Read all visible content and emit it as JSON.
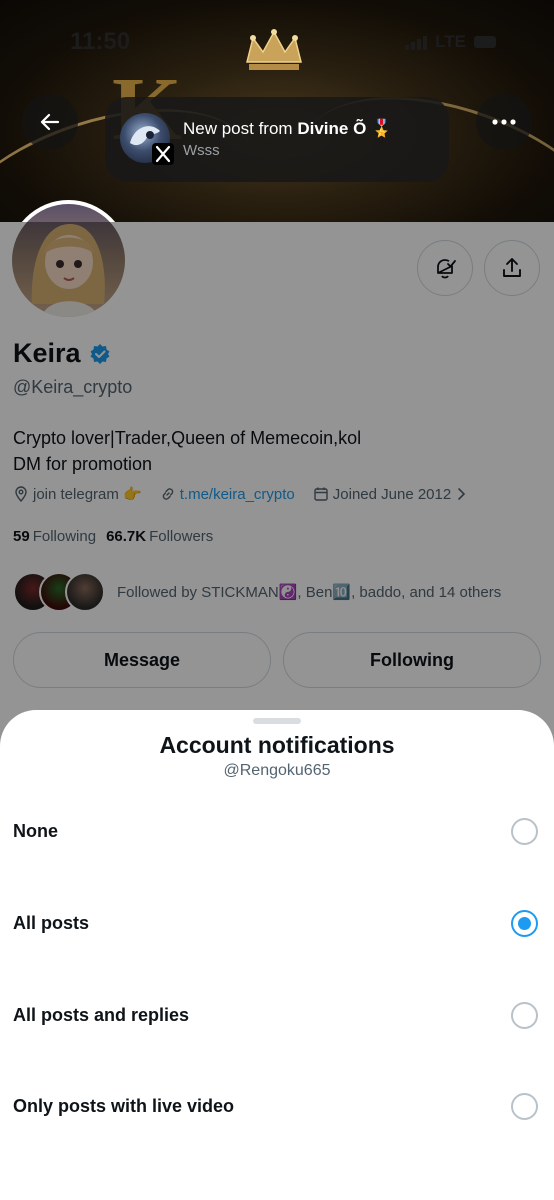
{
  "status_bar": {
    "time": "11:50",
    "network": "LTE"
  },
  "toast": {
    "title_prefix": "New post from",
    "author": "Divine Õ 🎖️",
    "body": "Wsss"
  },
  "profile": {
    "name": "Keira",
    "handle": "@Keira_crypto",
    "bio_line1": "Crypto lover|Trader,Queen of Memecoin,kol",
    "bio_line2": "DM for promotion",
    "location": "join telegram 👉",
    "website": "t.me/keira_crypto",
    "joined": "Joined June 2012",
    "following_count": "59",
    "following_label": "Following",
    "followers_count": "66.7K",
    "followers_label": "Followers",
    "followed_by": "Followed by STICKMAN☯️, Ben🔟, baddo, and 14 others",
    "message_label": "Message",
    "following_button": "Following",
    "verified_color": "#1d9bf0"
  },
  "sheet": {
    "title": "Account notifications",
    "subtitle": "@Rengoku665",
    "options": [
      {
        "label": "None",
        "selected": false
      },
      {
        "label": "All posts",
        "selected": true
      },
      {
        "label": "All posts and replies",
        "selected": false
      },
      {
        "label": "Only posts with live video",
        "selected": false
      }
    ]
  },
  "colors": {
    "accent": "#1d9bf0",
    "text": "#0f1419",
    "muted": "#536471"
  }
}
